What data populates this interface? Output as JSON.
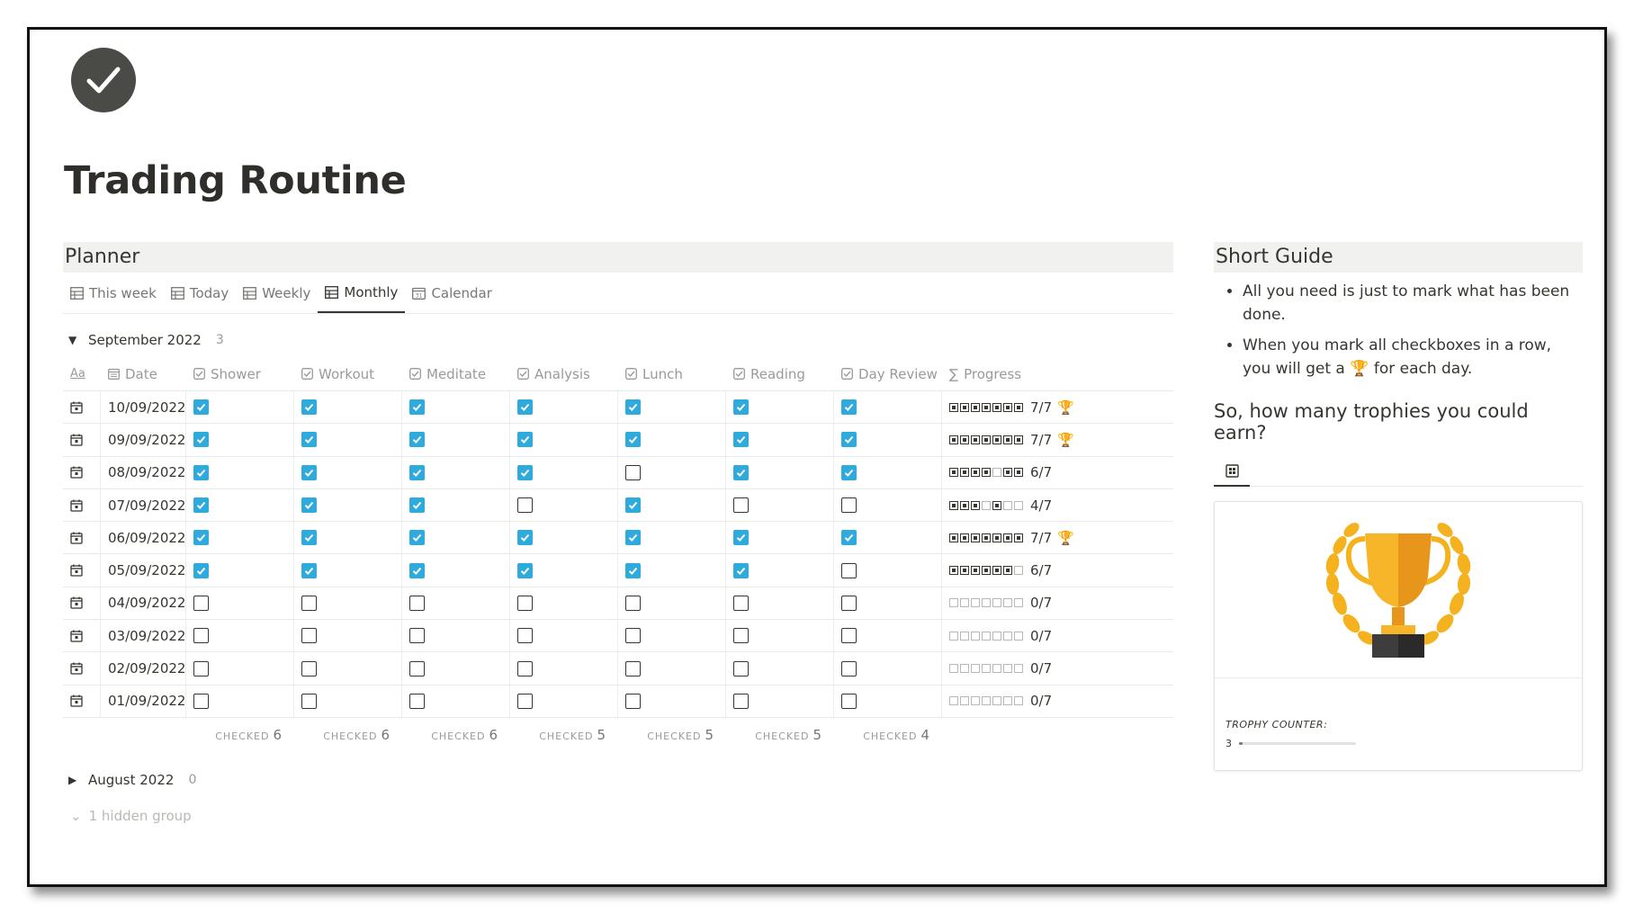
{
  "page": {
    "title": "Trading Routine"
  },
  "planner": {
    "title": "Planner",
    "tabs": [
      {
        "label": "This week",
        "active": false
      },
      {
        "label": "Today",
        "active": false
      },
      {
        "label": "Weekly",
        "active": false
      },
      {
        "label": "Monthly",
        "active": true
      },
      {
        "label": "Calendar",
        "active": false
      }
    ],
    "group": {
      "label": "September 2022",
      "count": "3"
    },
    "columns": [
      "Aa",
      "Date",
      "Shower",
      "Workout",
      "Meditate",
      "Analysis",
      "Lunch",
      "Reading",
      "Day Review",
      "Progress"
    ],
    "rows": [
      {
        "date": "10/09/2022",
        "checks": [
          1,
          1,
          1,
          1,
          1,
          1,
          1
        ],
        "progress": "7/7",
        "trophy": "🏆"
      },
      {
        "date": "09/09/2022",
        "checks": [
          1,
          1,
          1,
          1,
          1,
          1,
          1
        ],
        "progress": "7/7",
        "trophy": "🏆"
      },
      {
        "date": "08/09/2022",
        "checks": [
          1,
          1,
          1,
          1,
          0,
          1,
          1
        ],
        "progress": "6/7",
        "trophy": ""
      },
      {
        "date": "07/09/2022",
        "checks": [
          1,
          1,
          1,
          0,
          1,
          0,
          0
        ],
        "progress": "4/7",
        "trophy": ""
      },
      {
        "date": "06/09/2022",
        "checks": [
          1,
          1,
          1,
          1,
          1,
          1,
          1
        ],
        "progress": "7/7",
        "trophy": "🏆"
      },
      {
        "date": "05/09/2022",
        "checks": [
          1,
          1,
          1,
          1,
          1,
          1,
          0
        ],
        "progress": "6/7",
        "trophy": ""
      },
      {
        "date": "04/09/2022",
        "checks": [
          0,
          0,
          0,
          0,
          0,
          0,
          0
        ],
        "progress": "0/7",
        "trophy": ""
      },
      {
        "date": "03/09/2022",
        "checks": [
          0,
          0,
          0,
          0,
          0,
          0,
          0
        ],
        "progress": "0/7",
        "trophy": ""
      },
      {
        "date": "02/09/2022",
        "checks": [
          0,
          0,
          0,
          0,
          0,
          0,
          0
        ],
        "progress": "0/7",
        "trophy": ""
      },
      {
        "date": "01/09/2022",
        "checks": [
          0,
          0,
          0,
          0,
          0,
          0,
          0
        ],
        "progress": "0/7",
        "trophy": ""
      }
    ],
    "summary_label": "CHECKED",
    "summary": [
      "6",
      "6",
      "6",
      "5",
      "5",
      "5",
      "4"
    ],
    "group2": {
      "label": "August 2022",
      "count": "0"
    },
    "hidden": "1 hidden group"
  },
  "guide": {
    "title": "Short Guide",
    "bullets": [
      "All you need is just to mark what has been done.",
      "When you mark all checkboxes in a row, you will get a 🏆 for each day."
    ],
    "question": "So, how many trophies you could earn?",
    "card": {
      "label": "TROPHY COUNTER:",
      "value": "3",
      "fraction": 0.03
    }
  },
  "colors": {
    "check_on": "#2eaadc",
    "title": "#2f2e2a",
    "header_bg": "#f1f1ef"
  }
}
